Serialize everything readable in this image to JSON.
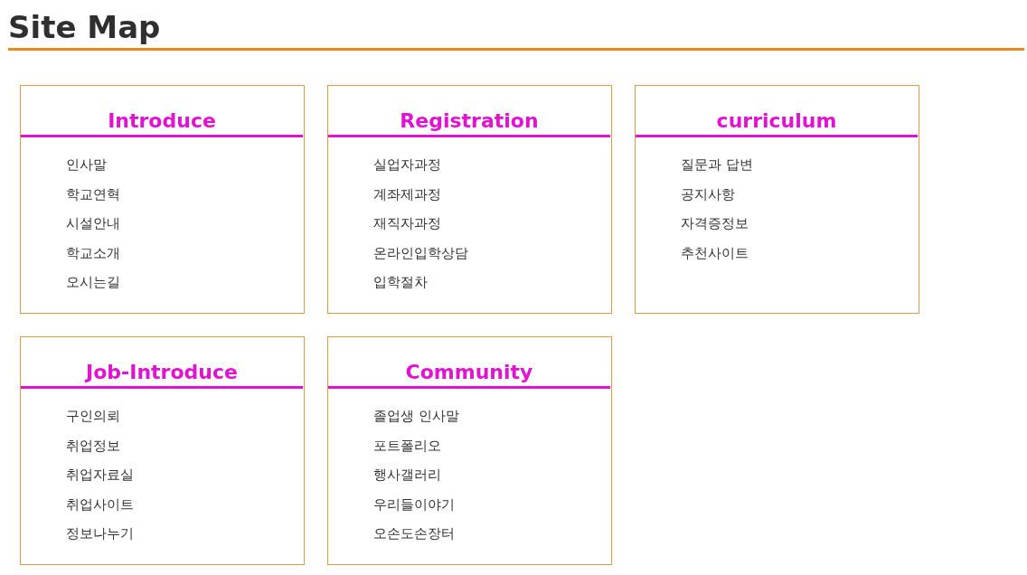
{
  "title": "Site Map",
  "sections": [
    {
      "heading": "Introduce",
      "links": [
        "인사말",
        "학교연혁",
        "시설안내",
        "학교소개",
        "오시는길"
      ]
    },
    {
      "heading": "Registration",
      "links": [
        "실업자과정",
        "계좌제과정",
        "재직자과정",
        "온라인입학상담",
        "입학절차"
      ]
    },
    {
      "heading": "curriculum",
      "links": [
        "질문과 답변",
        "공지사항",
        "자격증정보",
        "추천사이트"
      ]
    },
    {
      "heading": "Job-Introduce",
      "links": [
        "구인의뢰",
        "취업정보",
        "취업자료실",
        "취업사이트",
        "정보나누기"
      ]
    },
    {
      "heading": "Community",
      "links": [
        "졸업생 인사말",
        "포트폴리오",
        "행사갤러리",
        "우리들이야기",
        "오손도손장터"
      ]
    }
  ]
}
